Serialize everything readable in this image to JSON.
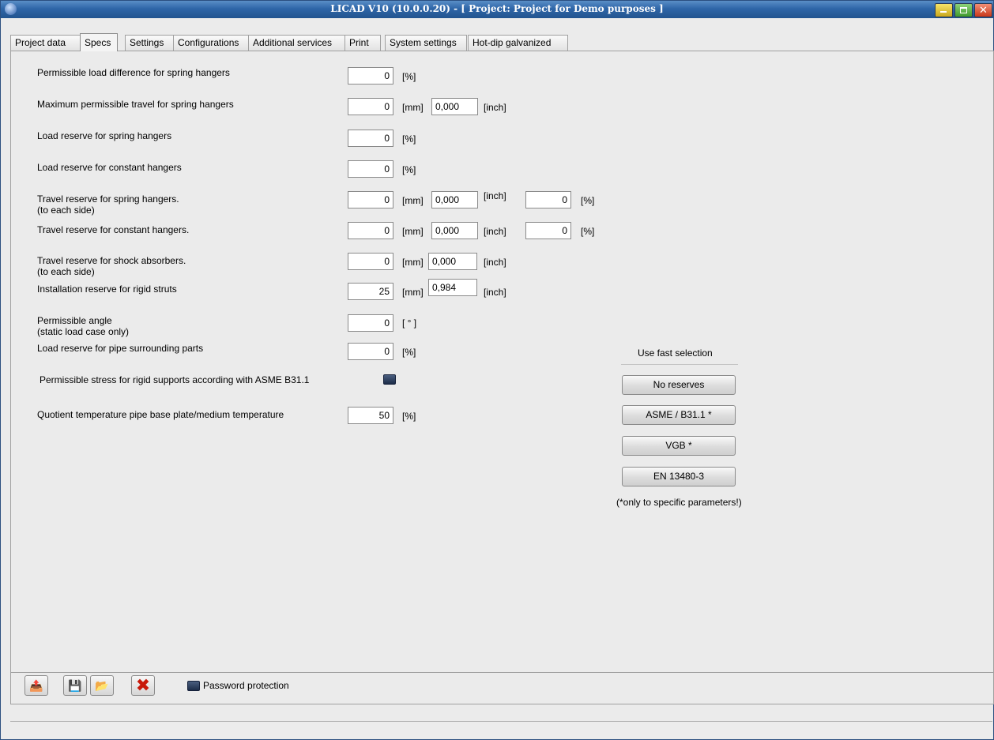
{
  "window": {
    "title": "LICAD V10 (10.0.0.20) -  [ Project: Project for Demo purposes ]"
  },
  "tabs": [
    {
      "label": "Project data"
    },
    {
      "label": "Specs",
      "active": true
    },
    {
      "label": "Settings"
    },
    {
      "label": "Configurations"
    },
    {
      "label": "Additional services"
    },
    {
      "label": "Print"
    },
    {
      "label": "System settings"
    },
    {
      "label": "Hot-dip galvanized"
    }
  ],
  "units": {
    "percent": "[%]",
    "mm": "[mm]",
    "inch": "[inch]",
    "degree": "[ ° ]"
  },
  "specs": {
    "load_diff_spring": {
      "label": "Permissible load difference for spring hangers",
      "value": "0"
    },
    "max_travel_spring": {
      "label": "Maximum permissible travel for spring hangers",
      "mm": "0",
      "inch": "0,000"
    },
    "load_reserve_spring": {
      "label": "Load reserve for spring hangers",
      "value": "0"
    },
    "load_reserve_constant": {
      "label": "Load reserve for constant hangers",
      "value": "0"
    },
    "travel_reserve_spring": {
      "label": "Travel reserve for spring hangers.",
      "sublabel": "(to each side)",
      "mm": "0",
      "inch": "0,000",
      "percent": "0"
    },
    "travel_reserve_constant": {
      "label": "Travel reserve for constant hangers.",
      "mm": "0",
      "inch": "0,000",
      "percent": "0"
    },
    "travel_reserve_shock": {
      "label": "Travel reserve for shock absorbers.",
      "sublabel": "(to each side)",
      "mm": "0",
      "inch": "0,000"
    },
    "installation_reserve": {
      "label": "Installation reserve for rigid struts",
      "mm": "25",
      "inch": "0,984"
    },
    "permissible_angle": {
      "label": "Permissible angle",
      "sublabel": "(static load case only)",
      "value": "0"
    },
    "load_reserve_pipe": {
      "label": "Load reserve for pipe surrounding parts",
      "value": "0"
    },
    "asme_stress": {
      "label": "Permissible stress for rigid supports according with ASME B31.1",
      "checked": false
    },
    "quotient_temp": {
      "label": "Quotient temperature pipe base plate/medium temperature",
      "value": "50"
    }
  },
  "fast_selection": {
    "title": "Use fast selection",
    "buttons": [
      "No reserves",
      "ASME / B31.1 *",
      "VGB *",
      "EN 13480-3"
    ],
    "note": "(*only to specific parameters!)"
  },
  "toolbar": {
    "password_label": "Password protection"
  }
}
